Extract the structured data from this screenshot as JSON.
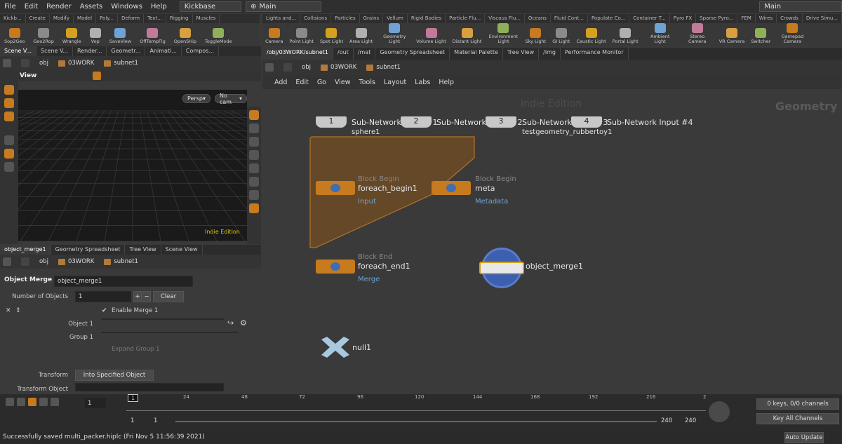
{
  "menubar": {
    "items": [
      "File",
      "Edit",
      "Render",
      "Assets",
      "Windows",
      "Help"
    ],
    "desktop": "Kickbase",
    "context": "Main",
    "right_desktop": "Main"
  },
  "shelf_left": {
    "tabs": [
      "Kickb...",
      "Create",
      "Modify",
      "Model",
      "Poly...",
      "Deform",
      "Text...",
      "Rigging",
      "Muscles"
    ],
    "tools": [
      "Sop2Geo",
      "Geo2Rop",
      "Wrangle",
      "Vop",
      "SaveView",
      "OffTempFlg",
      "OpenSHip",
      "ToggleMode"
    ]
  },
  "shelf_right": {
    "tabs": [
      "Lights and...",
      "Collisions",
      "Particles",
      "Grains",
      "Vellum",
      "Rigid Bodies",
      "Particle Flu...",
      "Viscous Flu...",
      "Oceans",
      "Fluid Cont...",
      "Populate Co...",
      "Container T...",
      "Pyro FX",
      "Sparse Pyro...",
      "FEM",
      "Wires",
      "Crowds",
      "Drive Simu..."
    ],
    "tools": [
      "Camera",
      "Point Light",
      "Spot Light",
      "Area Light",
      "Geometry Light",
      "Volume Light",
      "Distant Light",
      "Environment Light",
      "Sky Light",
      "GI Light",
      "Caustic Light",
      "Portal Light",
      "Ambient Light",
      "Stereo Camera",
      "VR Camera",
      "Switcher",
      "Gamepad Camera"
    ]
  },
  "left_top": {
    "tabs": [
      "Scene V...",
      "Scene V...",
      "Render...",
      "Geometr...",
      "Animati...",
      "Compos..."
    ],
    "path": [
      "obj",
      "03WORK",
      "subnet1"
    ],
    "view_title": "View",
    "persp": "Persp",
    "cam": "No cam",
    "watermark": "Indie Edition"
  },
  "param": {
    "tabs": [
      "object_merge1",
      "Geometry Spreadsheet",
      "Tree View",
      "Scene View"
    ],
    "path": [
      "obj",
      "03WORK",
      "subnet1"
    ],
    "node_type": "Object Merge",
    "node_name": "object_merge1",
    "num_label": "Number of Objects",
    "num_value": "1",
    "clear": "Clear",
    "enable": "Enable Merge 1",
    "object1": "Object 1",
    "group1": "Group 1",
    "expand": "Expand Group 1",
    "transform": "Transform",
    "transform_value": "Into Specified Object",
    "transform_object": "Transform Object"
  },
  "network": {
    "tabs": [
      "/obj/03WORK/subnet1",
      "/out",
      "/mat",
      "Geometry Spreadsheet",
      "Material Palette",
      "Tree View",
      "/img",
      "Performance Monitor"
    ],
    "path": [
      "obj",
      "03WORK",
      "subnet1"
    ],
    "menu": [
      "Add",
      "Edit",
      "Go",
      "View",
      "Tools",
      "Layout",
      "Labs",
      "Help"
    ],
    "watermark": "Indie Edition",
    "context_label": "Geometry",
    "inputs": [
      {
        "num": "1",
        "label": "Sub-Network Input #1",
        "sub": "sphere1"
      },
      {
        "num": "2",
        "label": "Sub-Network Input #2",
        "sub": ""
      },
      {
        "num": "3",
        "label": "Sub-Network Input #3",
        "sub": "testgeometry_rubbertoy1"
      },
      {
        "num": "4",
        "label": "Sub-Network Input #4",
        "sub": ""
      }
    ],
    "foreach_begin": {
      "type": "Block Begin",
      "name": "foreach_begin1",
      "method": "Input"
    },
    "meta": {
      "type": "Block Begin",
      "name": "meta",
      "method": "Metadata"
    },
    "foreach_end": {
      "type": "Block End",
      "name": "foreach_end1",
      "method": "Merge"
    },
    "object_merge": {
      "name": "object_merge1"
    },
    "null": {
      "name": "null1"
    }
  },
  "timeline": {
    "frame": "1",
    "ticks": [
      "24",
      "48",
      "72",
      "96",
      "120",
      "144",
      "168",
      "192",
      "216",
      "2"
    ],
    "start": "1",
    "start2": "1",
    "end": "240",
    "end2": "240",
    "keys": "0 keys, 0/0 channels",
    "key_all": "Key All Channels",
    "auto_update": "Auto Update"
  },
  "status": "Successfully saved multi_packer.hiplc (Fri Nov  5 11:56:39 2021)"
}
